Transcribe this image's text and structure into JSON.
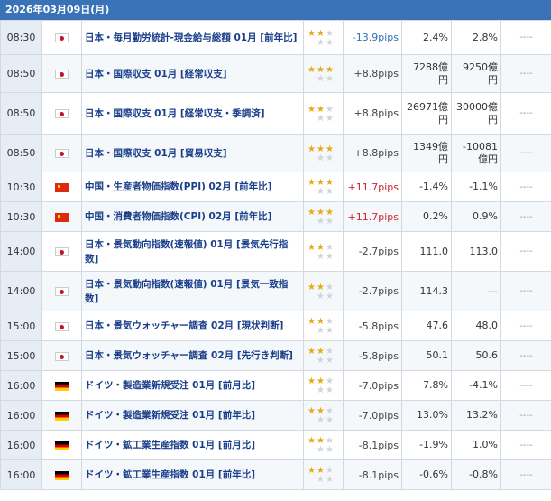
{
  "header": {
    "date": "2026年03月09日(月)"
  },
  "colors": {
    "header_bg": "#3a72b8",
    "time_bg": "#e6edf5",
    "star_on": "#e7a81b",
    "up_red": "#d0202e",
    "down_blue": "#2f6fb5"
  },
  "rows": [
    {
      "time": "08:30",
      "flag": "jp",
      "name": "日本・毎月勤労統計-現金給与総額 01月 [前年比]",
      "stars": 2,
      "pips": "-13.9pips",
      "pips_color": "blue",
      "actual": "2.4%",
      "forecast": "2.8%",
      "more": "----"
    },
    {
      "time": "08:50",
      "flag": "jp",
      "name": "日本・国際収支 01月 [経常収支]",
      "stars": 3,
      "pips": "+8.8pips",
      "pips_color": "gray",
      "actual": "7288億円",
      "forecast": "9250億円",
      "more": "----"
    },
    {
      "time": "08:50",
      "flag": "jp",
      "name": "日本・国際収支 01月 [経常収支・季調済]",
      "stars": 2,
      "pips": "+8.8pips",
      "pips_color": "gray",
      "actual": "26971億円",
      "forecast": "30000億円",
      "more": "----"
    },
    {
      "time": "08:50",
      "flag": "jp",
      "name": "日本・国際収支 01月 [貿易収支]",
      "stars": 3,
      "pips": "+8.8pips",
      "pips_color": "gray",
      "actual": "1349億円",
      "forecast": "-10081億円",
      "more": "----"
    },
    {
      "time": "10:30",
      "flag": "cn",
      "name": "中国・生産者物価指数(PPI) 02月 [前年比]",
      "stars": 3,
      "pips": "+11.7pips",
      "pips_color": "red",
      "actual": "-1.4%",
      "forecast": "-1.1%",
      "more": "----"
    },
    {
      "time": "10:30",
      "flag": "cn",
      "name": "中国・消費者物価指数(CPI) 02月 [前年比]",
      "stars": 3,
      "pips": "+11.7pips",
      "pips_color": "red",
      "actual": "0.2%",
      "forecast": "0.9%",
      "more": "----"
    },
    {
      "time": "14:00",
      "flag": "jp",
      "name": "日本・景気動向指数(速報値) 01月 [景気先行指数]",
      "stars": 2,
      "pips": "-2.7pips",
      "pips_color": "gray",
      "actual": "111.0",
      "forecast": "113.0",
      "more": "----"
    },
    {
      "time": "14:00",
      "flag": "jp",
      "name": "日本・景気動向指数(速報値) 01月 [景気一致指数]",
      "stars": 2,
      "pips": "-2.7pips",
      "pips_color": "gray",
      "actual": "114.3",
      "forecast": "---",
      "more": "----"
    },
    {
      "time": "15:00",
      "flag": "jp",
      "name": "日本・景気ウォッチャー調査 02月 [現状判断]",
      "stars": 2,
      "pips": "-5.8pips",
      "pips_color": "gray",
      "actual": "47.6",
      "forecast": "48.0",
      "more": "----"
    },
    {
      "time": "15:00",
      "flag": "jp",
      "name": "日本・景気ウォッチャー調査 02月 [先行き判断]",
      "stars": 2,
      "pips": "-5.8pips",
      "pips_color": "gray",
      "actual": "50.1",
      "forecast": "50.6",
      "more": "----"
    },
    {
      "time": "16:00",
      "flag": "de",
      "name": "ドイツ・製造業新規受注 01月 [前月比]",
      "stars": 2,
      "pips": "-7.0pips",
      "pips_color": "gray",
      "actual": "7.8%",
      "forecast": "-4.1%",
      "more": "----"
    },
    {
      "time": "16:00",
      "flag": "de",
      "name": "ドイツ・製造業新規受注 01月 [前年比]",
      "stars": 2,
      "pips": "-7.0pips",
      "pips_color": "gray",
      "actual": "13.0%",
      "forecast": "13.2%",
      "more": "----"
    },
    {
      "time": "16:00",
      "flag": "de",
      "name": "ドイツ・鉱工業生産指数 01月 [前月比]",
      "stars": 2,
      "pips": "-8.1pips",
      "pips_color": "gray",
      "actual": "-1.9%",
      "forecast": "1.0%",
      "more": "----"
    },
    {
      "time": "16:00",
      "flag": "de",
      "name": "ドイツ・鉱工業生産指数 01月 [前年比]",
      "stars": 2,
      "pips": "-8.1pips",
      "pips_color": "gray",
      "actual": "-0.6%",
      "forecast": "-0.8%",
      "more": "----"
    }
  ]
}
